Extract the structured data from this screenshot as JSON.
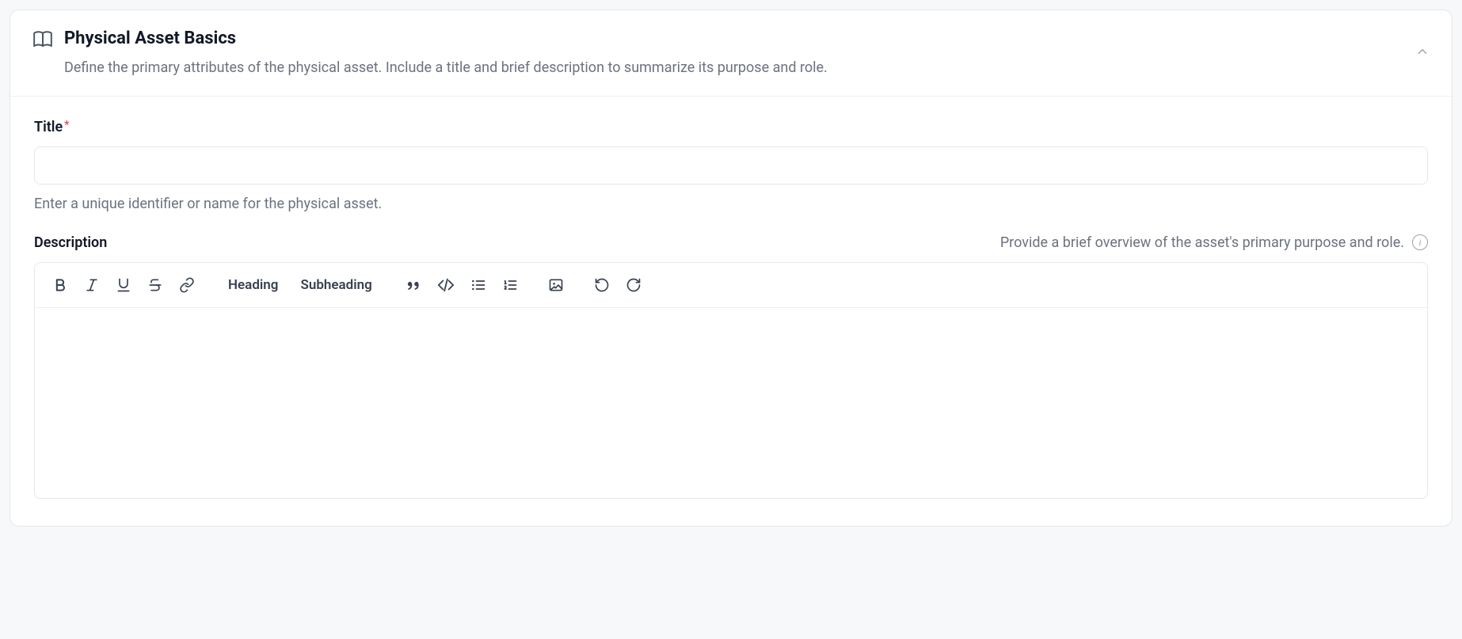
{
  "panel": {
    "title": "Physical Asset Basics",
    "subtitle": "Define the primary attributes of the physical asset. Include a title and brief description to summarize its purpose and role."
  },
  "title_field": {
    "label": "Title",
    "required_mark": "*",
    "value": "",
    "helper": "Enter a unique identifier or name for the physical asset."
  },
  "description_field": {
    "label": "Description",
    "hint": "Provide a brief overview of the asset's primary purpose and role.",
    "content": ""
  },
  "toolbar": {
    "heading_label": "Heading",
    "subheading_label": "Subheading"
  }
}
